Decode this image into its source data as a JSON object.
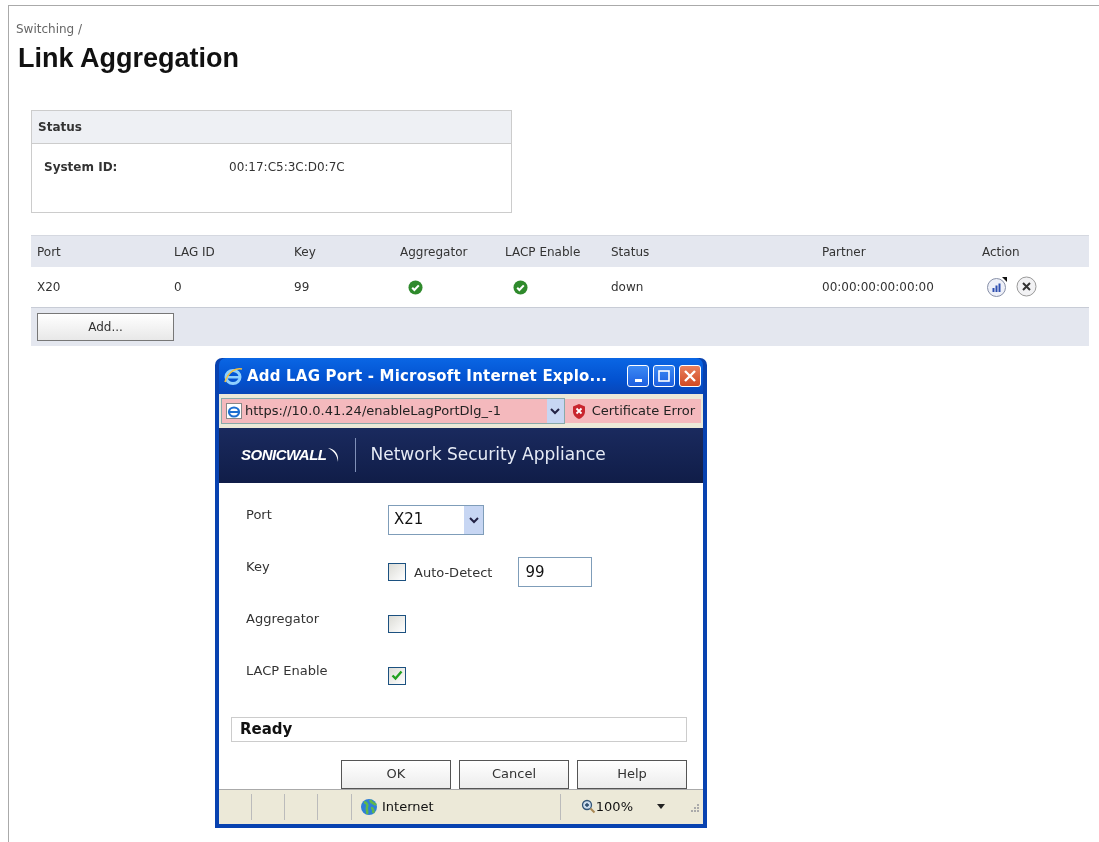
{
  "breadcrumb": "Switching /",
  "title": "Link Aggregation",
  "status_panel": {
    "heading": "Status",
    "rows": [
      {
        "label": "System ID:",
        "value": "00:17:C5:3C:D0:7C"
      }
    ]
  },
  "lag_table": {
    "columns": [
      "Port",
      "LAG ID",
      "Key",
      "Aggregator",
      "LACP Enable",
      "Status",
      "Partner",
      "Action"
    ],
    "rows": [
      {
        "port": "X20",
        "lag_id": "0",
        "key": "99",
        "aggregator": true,
        "lacp_enable": true,
        "status": "down",
        "partner": "00:00:00:00:00:00"
      }
    ]
  },
  "add_button": "Add...",
  "dialog": {
    "title": "Add LAG Port - Microsoft Internet Explo...",
    "address": "https://10.0.41.24/enableLagPortDlg_-1",
    "certificate": "Certificate Error",
    "brand": "SONICWALL",
    "product": "Network Security Appliance",
    "fields": [
      {
        "kind": "select",
        "label": "Port",
        "value": "X21"
      },
      {
        "kind": "key",
        "label": "Key",
        "checkbox_label": "Auto-Detect",
        "checked": false,
        "value": "99"
      },
      {
        "kind": "checkbox",
        "label": "Aggregator",
        "checked": false
      },
      {
        "kind": "checkbox",
        "label": "LACP Enable",
        "checked": true
      }
    ],
    "status": "Ready",
    "buttons": [
      "OK",
      "Cancel",
      "Help"
    ],
    "status_bar": {
      "zone": "Internet",
      "zoom": "100%"
    }
  }
}
